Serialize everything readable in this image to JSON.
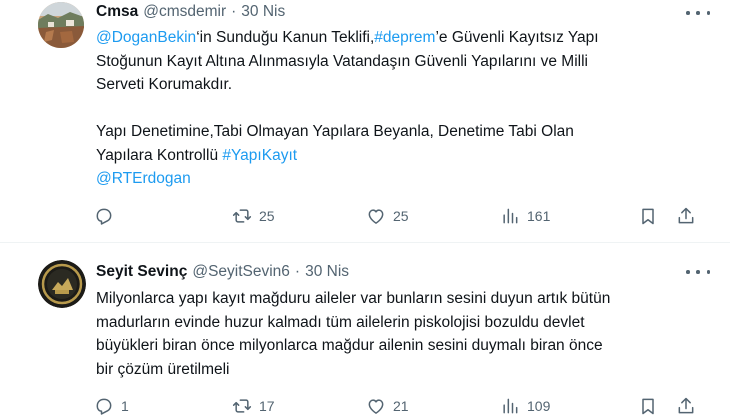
{
  "tweets": [
    {
      "display_name": "Cmsa",
      "handle": "@cmsdemir",
      "separator": "·",
      "time": "30 Nis",
      "lines": [
        [
          {
            "t": "@DoganBekin",
            "link": true
          },
          {
            "t": "‘in Sunduğu Kanun Teklifi,",
            "link": false
          },
          {
            "t": "#deprem",
            "link": true
          },
          {
            "t": "’e Güvenli Kayıtsız Yapı",
            "link": false
          }
        ],
        [
          {
            "t": "Stoğunun Kayıt Altına Alınmasıyla Vatandaşın Güvenli Yapılarını ve Milli",
            "link": false
          }
        ],
        [
          {
            "t": "Serveti Korumakdır.",
            "link": false
          }
        ],
        [],
        [
          {
            "t": "Yapı Denetimine,Tabi Olmayan Yapılara Beyanla, Denetime Tabi Olan",
            "link": false
          }
        ],
        [
          {
            "t": "Yapılara Kontrollü ",
            "link": false
          },
          {
            "t": "#YapıKayıt",
            "link": true
          }
        ],
        [
          {
            "t": "@RTErdogan",
            "link": true
          }
        ]
      ],
      "replies": "",
      "retweets": "25",
      "likes": "25",
      "views": "161",
      "avatar_icon": "landscape-photo-avatar"
    },
    {
      "display_name": "Seyit Sevinç",
      "handle": "@SeyitSevin6",
      "separator": "·",
      "time": "30 Nis",
      "lines": [
        [
          {
            "t": "Milyonlarca yapı kayıt mağduru aileler var bunların sesini duyun artık bütün",
            "link": false
          }
        ],
        [
          {
            "t": "madurların evinde huzur kalmadı tüm ailelerin piskolojisi bozuldu devlet",
            "link": false
          }
        ],
        [
          {
            "t": "büyükleri biran önce milyonlarca mağdur ailenin sesini duymalı biran önce",
            "link": false
          }
        ],
        [
          {
            "t": "bir çözüm üretilmeli",
            "link": false
          }
        ]
      ],
      "replies": "1",
      "retweets": "17",
      "likes": "21",
      "views": "109",
      "avatar_icon": "round-emblem-avatar"
    }
  ],
  "colors": {
    "link": "#1d9bf0",
    "text": "#0f1419",
    "muted": "#536471",
    "divider": "#eff3f4"
  }
}
